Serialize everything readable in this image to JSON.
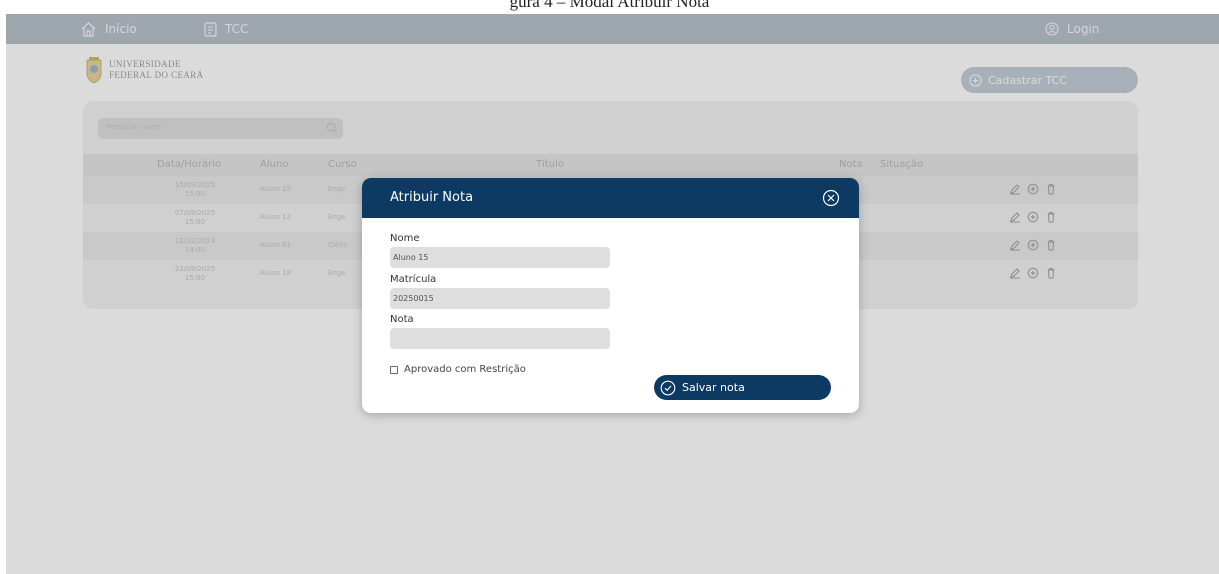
{
  "caption": "gura 4 – Modal Atribuir Nota",
  "nav": {
    "inicio": "Início",
    "tcc": "TCC",
    "login": "Login"
  },
  "logo": {
    "line1": "UNIVERSIDADE",
    "line2": "FEDERAL DO CEARÁ"
  },
  "toolbar": {
    "cadastrar_label": "Cadastrar TCC",
    "search_placeholder": "Pesquisar nome"
  },
  "table": {
    "headers": [
      "Data/Horário",
      "Aluno",
      "Curso",
      "Título",
      "Nota",
      "Situação"
    ],
    "rows": [
      {
        "date": "15/09/2025",
        "time": "15:00",
        "aluno": "Aluno 15",
        "curso": "Enge"
      },
      {
        "date": "07/09/2025",
        "time": "15:00",
        "aluno": "Aluno 12",
        "curso": "Enge"
      },
      {
        "date": "12/02/2024",
        "time": "14:00",
        "aluno": "Aluno 01",
        "curso": "Ciênc"
      },
      {
        "date": "23/09/2025",
        "time": "15:00",
        "aluno": "Aluno 18",
        "curso": "Enge"
      }
    ]
  },
  "modal": {
    "title": "Atribuir Nota",
    "nome_label": "Nome",
    "nome_value": "Aluno 15",
    "matricula_label": "Matrícula",
    "matricula_value": "20250015",
    "nota_label": "Nota",
    "nota_value": "",
    "checkbox_label": "Aprovado com Restrição",
    "save_label": "Salvar nota"
  },
  "colors": {
    "primary": "#0d3a63",
    "topbar": "#a7b1ba"
  }
}
